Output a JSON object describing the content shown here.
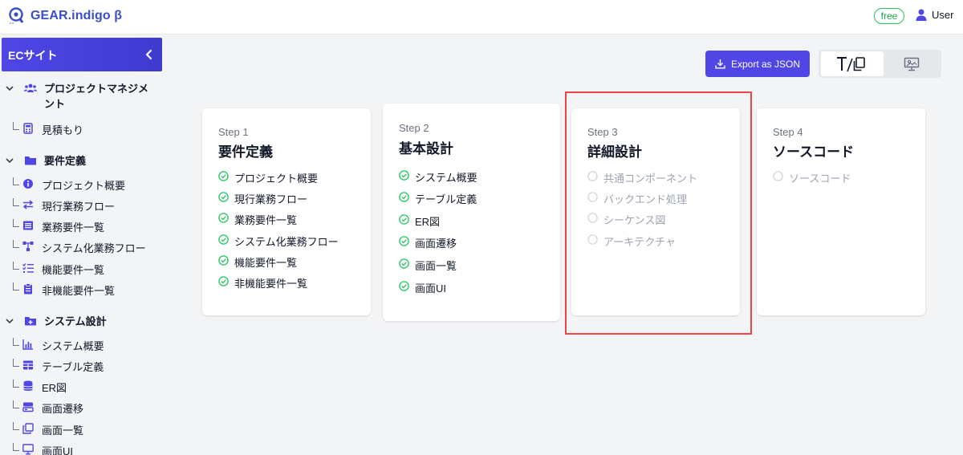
{
  "app": {
    "name": "GEAR.indigo β",
    "plan_badge": "free",
    "user_label": "User"
  },
  "colors": {
    "accent": "#4f46e5",
    "done": "#22c55e",
    "todo": "#d1d5db",
    "highlight": "#ef4444"
  },
  "sidebar": {
    "project_title": "ECサイト",
    "groups": [
      {
        "label": "プロジェクトマネジメント",
        "icon": "users-icon",
        "items": [
          {
            "label": "見積もり",
            "icon": "calculator-icon"
          }
        ]
      },
      {
        "label": "要件定義",
        "icon": "folder-icon",
        "items": [
          {
            "label": "プロジェクト概要",
            "icon": "info-icon"
          },
          {
            "label": "現行業務フロー",
            "icon": "arrows-icon"
          },
          {
            "label": "業務要件一覧",
            "icon": "list-icon"
          },
          {
            "label": "システム化業務フロー",
            "icon": "flow-icon"
          },
          {
            "label": "機能要件一覧",
            "icon": "checklist-icon"
          },
          {
            "label": "非機能要件一覧",
            "icon": "clipboard-icon"
          }
        ]
      },
      {
        "label": "システム設計",
        "icon": "folder-plus-icon",
        "items": [
          {
            "label": "システム概要",
            "icon": "chart-icon"
          },
          {
            "label": "テーブル定義",
            "icon": "table-icon"
          },
          {
            "label": "ER図",
            "icon": "database-icon"
          },
          {
            "label": "画面遷移",
            "icon": "transition-icon"
          },
          {
            "label": "画面一覧",
            "icon": "copy-icon"
          },
          {
            "label": "画面UI",
            "icon": "monitor-icon"
          }
        ]
      }
    ]
  },
  "toolbar": {
    "export_label": "Export as JSON",
    "view_toggle": [
      "text-copy-icon",
      "screen-icon"
    ]
  },
  "steps": [
    {
      "step": "Step 1",
      "title": "要件定義",
      "status": "done",
      "items": [
        "プロジェクト概要",
        "現行業務フロー",
        "業務要件一覧",
        "システム化業務フロー",
        "機能要件一覧",
        "非機能要件一覧"
      ]
    },
    {
      "step": "Step 2",
      "title": "基本設計",
      "status": "done",
      "items": [
        "システム概要",
        "テーブル定義",
        "ER図",
        "画面遷移",
        "画面一覧",
        "画面UI"
      ]
    },
    {
      "step": "Step 3",
      "title": "詳細設計",
      "status": "todo",
      "items": [
        "共通コンポーネント",
        "バックエンド処理",
        "シーケンス図",
        "アーキテクチャ"
      ]
    },
    {
      "step": "Step 4",
      "title": "ソースコード",
      "status": "todo",
      "items": [
        "ソースコード"
      ]
    }
  ]
}
